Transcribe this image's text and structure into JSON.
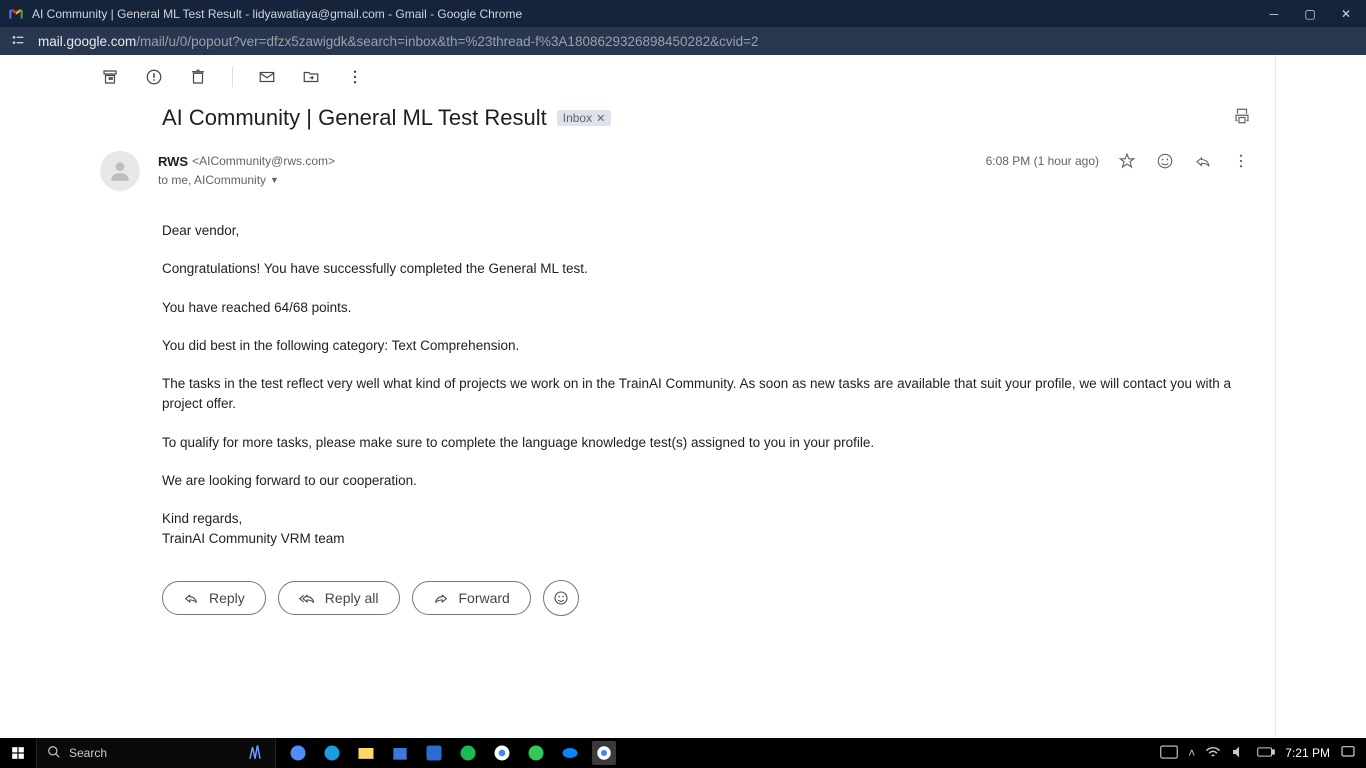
{
  "window": {
    "title": "AI Community | General ML Test Result - lidyawatiaya@gmail.com - Gmail - Google Chrome"
  },
  "url": {
    "domain": "mail.google.com",
    "path": "/mail/u/0/popout?ver=dfzx5zawigdk&search=inbox&th=%23thread-f%3A1808629326898450282&cvid=2"
  },
  "email": {
    "subject": "AI Community | General ML Test Result",
    "label": "Inbox",
    "sender_name": "RWS",
    "sender_email": "<AICommunity@rws.com>",
    "recipients_line": "to me, AICommunity",
    "timestamp": "6:08 PM (1 hour ago)",
    "body": {
      "p1": "Dear vendor,",
      "p2": "Congratulations! You have successfully completed the General ML test.",
      "p3": "You have reached 64/68 points.",
      "p4": "You did best in the following category: Text Comprehension.",
      "p5": "The tasks in the test reflect very well what kind of projects we work on in the TrainAI Community. As soon as new tasks are available that suit your profile, we will contact you with a project offer.",
      "p6": "To qualify for more tasks, please make sure to complete the language knowledge test(s) assigned to you in your profile.",
      "p7": "We are looking forward to our cooperation.",
      "p8a": "Kind regards,",
      "p8b": "TrainAI Community VRM team"
    },
    "actions": {
      "reply": "Reply",
      "reply_all": "Reply all",
      "forward": "Forward"
    }
  },
  "taskbar": {
    "search_placeholder": "Search",
    "clock": "7:21 PM"
  }
}
